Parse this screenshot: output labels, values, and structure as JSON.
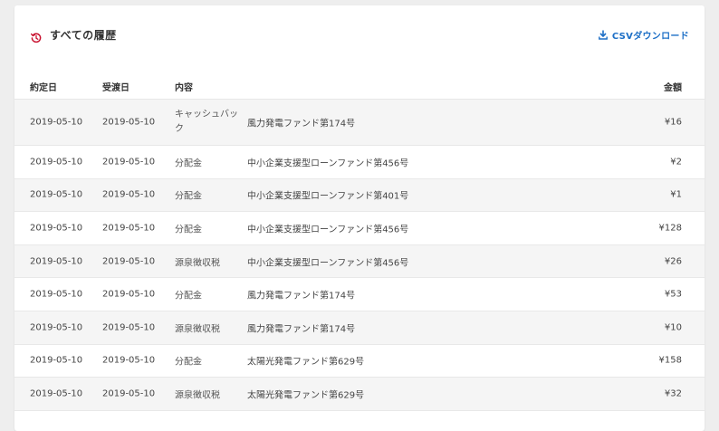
{
  "header": {
    "title": "すべての履歴",
    "history_icon": "history-icon",
    "csv_label": "CSVダウンロード",
    "csv_icon": "download-icon",
    "accent_color": "#c8102e",
    "link_color": "#1d6fc6"
  },
  "table": {
    "columns": {
      "contract_date": "約定日",
      "receive_date": "受渡日",
      "content": "内容",
      "amount": "金額"
    },
    "rows": [
      {
        "contract_date": "2019-05-10",
        "receive_date": "2019-05-10",
        "type": "キャッシュバック",
        "fund": "風力発電ファンド第174号",
        "amount": "¥16"
      },
      {
        "contract_date": "2019-05-10",
        "receive_date": "2019-05-10",
        "type": "分配金",
        "fund": "中小企業支援型ローンファンド第456号",
        "amount": "¥2"
      },
      {
        "contract_date": "2019-05-10",
        "receive_date": "2019-05-10",
        "type": "分配金",
        "fund": "中小企業支援型ローンファンド第401号",
        "amount": "¥1"
      },
      {
        "contract_date": "2019-05-10",
        "receive_date": "2019-05-10",
        "type": "分配金",
        "fund": "中小企業支援型ローンファンド第456号",
        "amount": "¥128"
      },
      {
        "contract_date": "2019-05-10",
        "receive_date": "2019-05-10",
        "type": "源泉徴収税",
        "fund": "中小企業支援型ローンファンド第456号",
        "amount": "¥26"
      },
      {
        "contract_date": "2019-05-10",
        "receive_date": "2019-05-10",
        "type": "分配金",
        "fund": "風力発電ファンド第174号",
        "amount": "¥53"
      },
      {
        "contract_date": "2019-05-10",
        "receive_date": "2019-05-10",
        "type": "源泉徴収税",
        "fund": "風力発電ファンド第174号",
        "amount": "¥10"
      },
      {
        "contract_date": "2019-05-10",
        "receive_date": "2019-05-10",
        "type": "分配金",
        "fund": "太陽光発電ファンド第629号",
        "amount": "¥158"
      },
      {
        "contract_date": "2019-05-10",
        "receive_date": "2019-05-10",
        "type": "源泉徴収税",
        "fund": "太陽光発電ファンド第629号",
        "amount": "¥32"
      }
    ]
  }
}
